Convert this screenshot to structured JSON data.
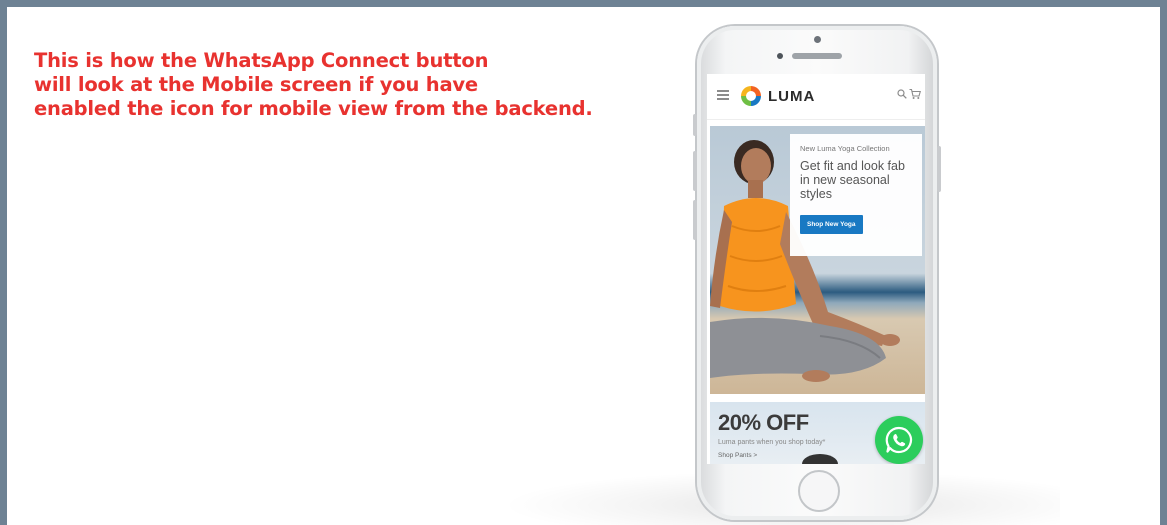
{
  "caption": {
    "lines": [
      "This is how the WhatsApp Connect button",
      "will look at the Mobile screen if you have",
      "enabled the icon for mobile view from the backend."
    ]
  },
  "phone_screen": {
    "header": {
      "logo_text": "LUMA",
      "icons": [
        "menu-icon",
        "luma-logo-icon",
        "search-icon",
        "cart-icon"
      ]
    },
    "hero": {
      "small_text": "New Luma Yoga Collection",
      "headline": "Get fit and look fab in new seasonal styles",
      "button_label": "Shop New Yoga"
    },
    "sale": {
      "title": "20% OFF",
      "subtitle": "Luma pants when you shop today*",
      "link": "Shop Pants >"
    },
    "whatsapp_button": {
      "icon": "whatsapp-icon",
      "color": "#2ccd5c"
    }
  },
  "colors": {
    "caption": "#e8322f",
    "frame_border": "#6e8294",
    "shop_button": "#1979c3"
  }
}
